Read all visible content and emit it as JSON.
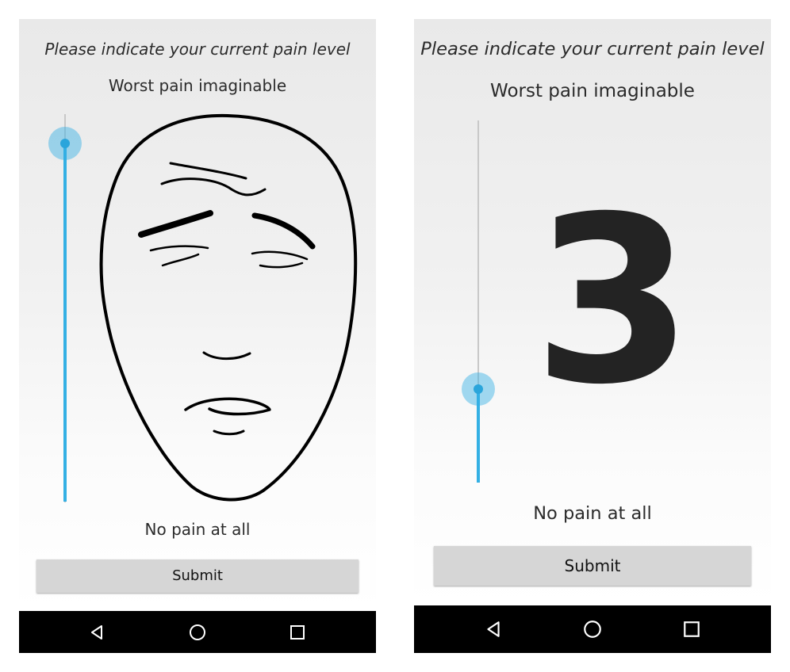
{
  "screens": [
    {
      "prompt": "Please indicate your current pain level",
      "top_label": "Worst pain imaginable",
      "bottom_label": "No pain at all",
      "slider_level": 1.0,
      "display": "face",
      "submit_label": "Submit"
    },
    {
      "prompt": "Please indicate your current pain level",
      "top_label": "Worst pain imaginable",
      "bottom_label": "No pain at all",
      "slider_level": 0.26,
      "display_value": "3",
      "submit_label": "Submit"
    }
  ],
  "navbar": {
    "buttons": [
      "back-icon",
      "home-icon",
      "recents-icon"
    ]
  },
  "colors": {
    "accent": "#34b0e4",
    "track": "#c8c8c8",
    "navbar": "#000000",
    "button": "#d6d6d6"
  }
}
